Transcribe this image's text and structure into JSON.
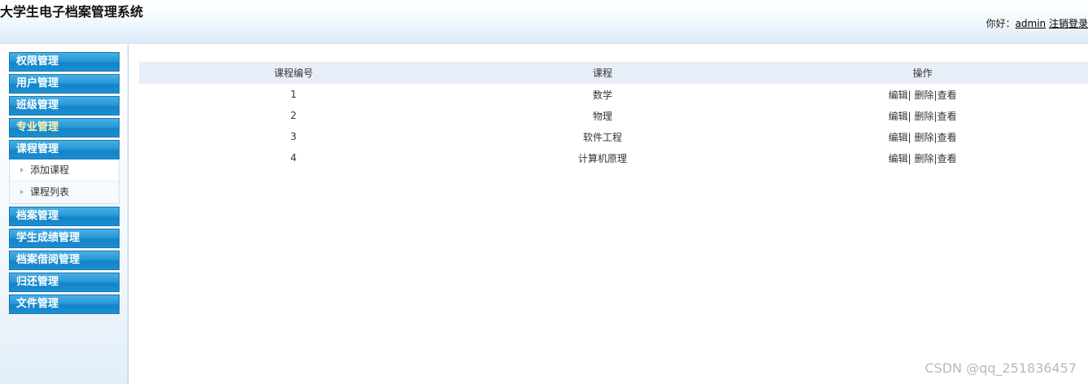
{
  "header": {
    "title": "大学生电子档案管理系统",
    "greeting": "你好：",
    "username": "admin",
    "logout": "注销登录"
  },
  "sidebar": {
    "menus": [
      {
        "label": "权限管理"
      },
      {
        "label": "用户管理"
      },
      {
        "label": "班级管理"
      },
      {
        "label": "专业管理"
      },
      {
        "label": "课程管理",
        "sub": [
          "添加课程",
          "课程列表"
        ]
      },
      {
        "label": "档案管理"
      },
      {
        "label": "学生成绩管理"
      },
      {
        "label": "档案借阅管理"
      },
      {
        "label": "归还管理"
      },
      {
        "label": "文件管理"
      }
    ]
  },
  "table": {
    "headers": [
      "课程编号",
      "课程",
      "操作"
    ],
    "rows": [
      {
        "id": "1",
        "name": "数学"
      },
      {
        "id": "2",
        "name": "物理"
      },
      {
        "id": "3",
        "name": "软件工程"
      },
      {
        "id": "4",
        "name": "计算机原理"
      }
    ],
    "actions": {
      "edit": "编辑",
      "delete": "删除",
      "view": "查看",
      "sep": "|"
    }
  },
  "watermark": "CSDN @qq_251836457",
  "colors": {
    "menu_head": "#1a8fd3",
    "active_menu_text": "#fff7a8",
    "table_header_bg": "#e8eef7"
  }
}
